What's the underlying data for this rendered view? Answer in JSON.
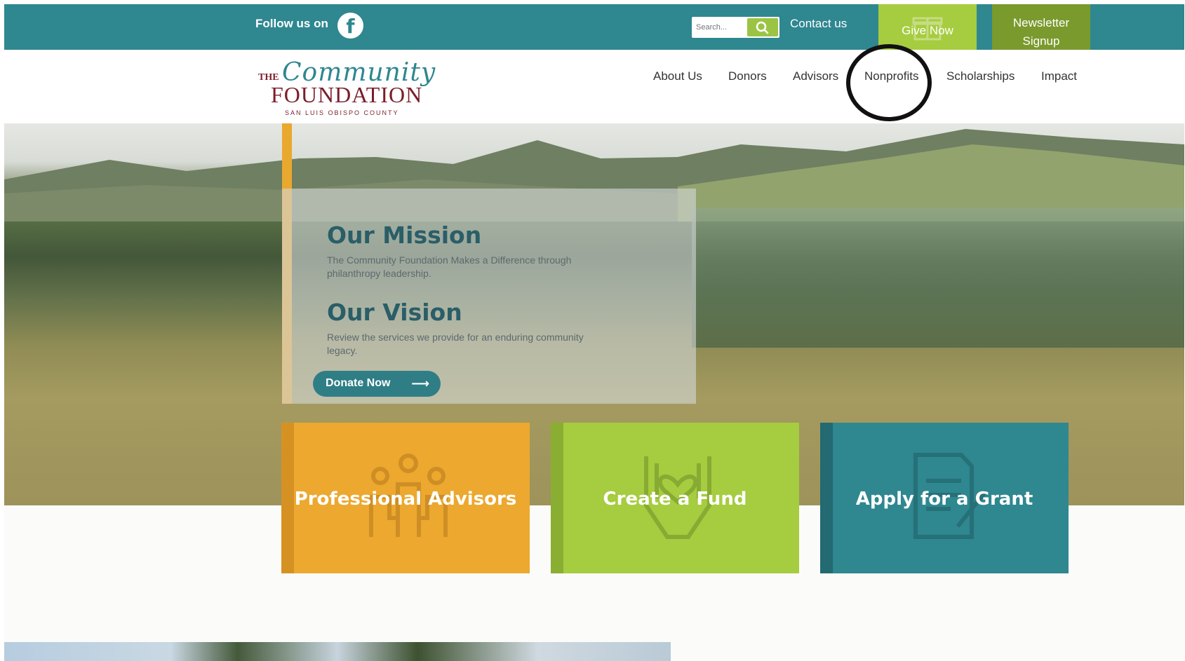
{
  "topbar": {
    "follow_label": "Follow us on",
    "facebook_glyph": "f",
    "search_placeholder": "Search...",
    "contact_label": "Contact us",
    "give_label": "Give Now",
    "newsletter_label": "Newsletter Signup",
    "colors": {
      "bar": "#2f8790",
      "give": "#a6cc3f",
      "newsletter": "#7a9a2d"
    }
  },
  "logo": {
    "the": "THE",
    "script": "Community",
    "main": "FOUNDATION",
    "county": "SAN LUIS OBISPO COUNTY"
  },
  "nav": {
    "items": [
      "About Us",
      "Donors",
      "Advisors",
      "Nonprofits",
      "Scholarships",
      "Impact"
    ]
  },
  "hero": {
    "mission_title": "Our Mission",
    "mission_text": "The Community Foundation Makes a Difference through philanthropy leadership.",
    "vision_title": "Our Vision",
    "vision_text": "Review the services we provide for an enduring community legacy.",
    "donate_label": "Donate Now",
    "donate_arrow": "⟶"
  },
  "cards": [
    {
      "title": "Professional Advisors",
      "icon": "people-group-icon"
    },
    {
      "title": "Create a Fund",
      "icon": "hands-heart-icon"
    },
    {
      "title": "Apply for a Grant",
      "icon": "document-pen-icon"
    }
  ]
}
